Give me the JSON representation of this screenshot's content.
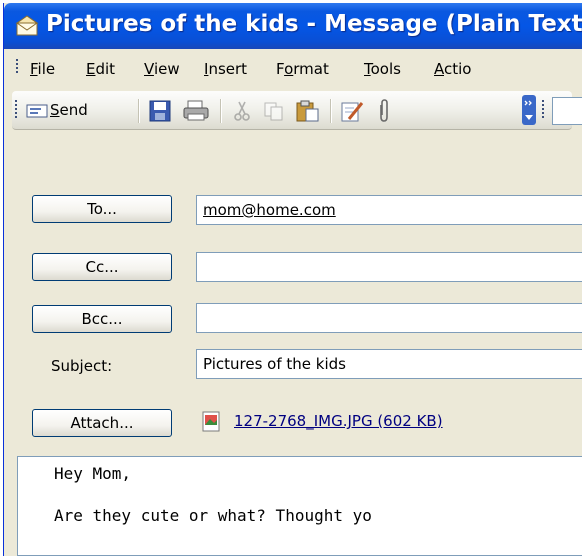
{
  "window": {
    "title": "Pictures of the kids - Message (Plain Text)",
    "colors": {
      "titlebar": "#0456e6",
      "chrome": "#ece9d8",
      "field_border": "#7f9db9"
    }
  },
  "menu": {
    "items": [
      "File",
      "Edit",
      "View",
      "Insert",
      "Format",
      "Tools",
      "Actio"
    ],
    "mnemonics": [
      "F",
      "E",
      "V",
      "I",
      "o",
      "T",
      "A"
    ]
  },
  "toolbar": {
    "send_label": "Send",
    "buttons": [
      "send-icon",
      "save-icon",
      "print-icon",
      "cut-icon",
      "copy-icon",
      "paste-icon",
      "check-names-icon",
      "attach-icon"
    ]
  },
  "header": {
    "to_button": "To...",
    "cc_button": "Cc...",
    "bcc_button": "Bcc...",
    "subject_label": "Subject:",
    "attach_button": "Attach...",
    "to_value": "mom@home.com",
    "cc_value": "",
    "bcc_value": "",
    "subject_value": "Pictures of the kids",
    "attachment_name": "127-2768_IMG.JPG (602 KB)"
  },
  "body": {
    "text": "Hey Mom,\n\nAre they cute or what? Thought yo"
  }
}
